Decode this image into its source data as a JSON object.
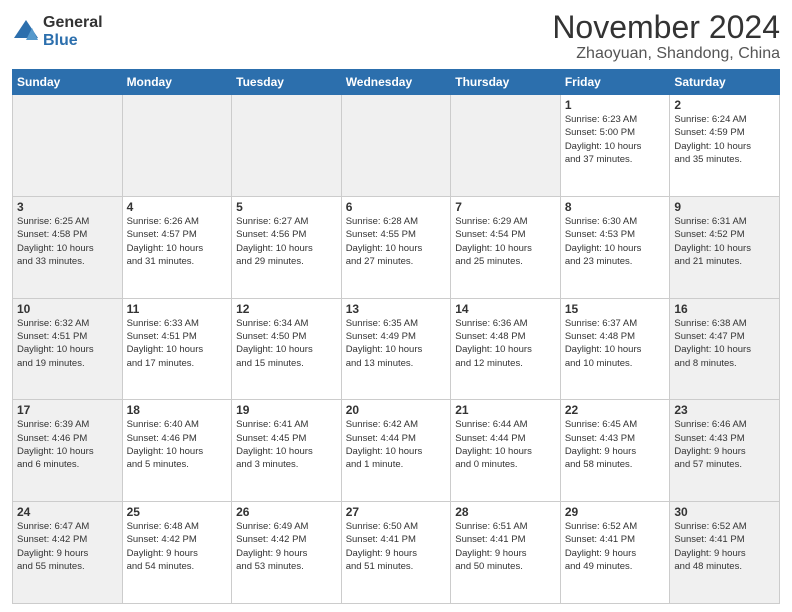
{
  "logo": {
    "general": "General",
    "blue": "Blue"
  },
  "header": {
    "month": "November 2024",
    "location": "Zhaoyuan, Shandong, China"
  },
  "weekdays": [
    "Sunday",
    "Monday",
    "Tuesday",
    "Wednesday",
    "Thursday",
    "Friday",
    "Saturday"
  ],
  "weeks": [
    [
      {
        "day": "",
        "info": "",
        "shaded": true
      },
      {
        "day": "",
        "info": "",
        "shaded": true
      },
      {
        "day": "",
        "info": "",
        "shaded": true
      },
      {
        "day": "",
        "info": "",
        "shaded": true
      },
      {
        "day": "",
        "info": "",
        "shaded": true
      },
      {
        "day": "1",
        "info": "Sunrise: 6:23 AM\nSunset: 5:00 PM\nDaylight: 10 hours\nand 37 minutes.",
        "shaded": false
      },
      {
        "day": "2",
        "info": "Sunrise: 6:24 AM\nSunset: 4:59 PM\nDaylight: 10 hours\nand 35 minutes.",
        "shaded": false
      }
    ],
    [
      {
        "day": "3",
        "info": "Sunrise: 6:25 AM\nSunset: 4:58 PM\nDaylight: 10 hours\nand 33 minutes.",
        "shaded": true
      },
      {
        "day": "4",
        "info": "Sunrise: 6:26 AM\nSunset: 4:57 PM\nDaylight: 10 hours\nand 31 minutes.",
        "shaded": false
      },
      {
        "day": "5",
        "info": "Sunrise: 6:27 AM\nSunset: 4:56 PM\nDaylight: 10 hours\nand 29 minutes.",
        "shaded": false
      },
      {
        "day": "6",
        "info": "Sunrise: 6:28 AM\nSunset: 4:55 PM\nDaylight: 10 hours\nand 27 minutes.",
        "shaded": false
      },
      {
        "day": "7",
        "info": "Sunrise: 6:29 AM\nSunset: 4:54 PM\nDaylight: 10 hours\nand 25 minutes.",
        "shaded": false
      },
      {
        "day": "8",
        "info": "Sunrise: 6:30 AM\nSunset: 4:53 PM\nDaylight: 10 hours\nand 23 minutes.",
        "shaded": false
      },
      {
        "day": "9",
        "info": "Sunrise: 6:31 AM\nSunset: 4:52 PM\nDaylight: 10 hours\nand 21 minutes.",
        "shaded": true
      }
    ],
    [
      {
        "day": "10",
        "info": "Sunrise: 6:32 AM\nSunset: 4:51 PM\nDaylight: 10 hours\nand 19 minutes.",
        "shaded": true
      },
      {
        "day": "11",
        "info": "Sunrise: 6:33 AM\nSunset: 4:51 PM\nDaylight: 10 hours\nand 17 minutes.",
        "shaded": false
      },
      {
        "day": "12",
        "info": "Sunrise: 6:34 AM\nSunset: 4:50 PM\nDaylight: 10 hours\nand 15 minutes.",
        "shaded": false
      },
      {
        "day": "13",
        "info": "Sunrise: 6:35 AM\nSunset: 4:49 PM\nDaylight: 10 hours\nand 13 minutes.",
        "shaded": false
      },
      {
        "day": "14",
        "info": "Sunrise: 6:36 AM\nSunset: 4:48 PM\nDaylight: 10 hours\nand 12 minutes.",
        "shaded": false
      },
      {
        "day": "15",
        "info": "Sunrise: 6:37 AM\nSunset: 4:48 PM\nDaylight: 10 hours\nand 10 minutes.",
        "shaded": false
      },
      {
        "day": "16",
        "info": "Sunrise: 6:38 AM\nSunset: 4:47 PM\nDaylight: 10 hours\nand 8 minutes.",
        "shaded": true
      }
    ],
    [
      {
        "day": "17",
        "info": "Sunrise: 6:39 AM\nSunset: 4:46 PM\nDaylight: 10 hours\nand 6 minutes.",
        "shaded": true
      },
      {
        "day": "18",
        "info": "Sunrise: 6:40 AM\nSunset: 4:46 PM\nDaylight: 10 hours\nand 5 minutes.",
        "shaded": false
      },
      {
        "day": "19",
        "info": "Sunrise: 6:41 AM\nSunset: 4:45 PM\nDaylight: 10 hours\nand 3 minutes.",
        "shaded": false
      },
      {
        "day": "20",
        "info": "Sunrise: 6:42 AM\nSunset: 4:44 PM\nDaylight: 10 hours\nand 1 minute.",
        "shaded": false
      },
      {
        "day": "21",
        "info": "Sunrise: 6:44 AM\nSunset: 4:44 PM\nDaylight: 10 hours\nand 0 minutes.",
        "shaded": false
      },
      {
        "day": "22",
        "info": "Sunrise: 6:45 AM\nSunset: 4:43 PM\nDaylight: 9 hours\nand 58 minutes.",
        "shaded": false
      },
      {
        "day": "23",
        "info": "Sunrise: 6:46 AM\nSunset: 4:43 PM\nDaylight: 9 hours\nand 57 minutes.",
        "shaded": true
      }
    ],
    [
      {
        "day": "24",
        "info": "Sunrise: 6:47 AM\nSunset: 4:42 PM\nDaylight: 9 hours\nand 55 minutes.",
        "shaded": true
      },
      {
        "day": "25",
        "info": "Sunrise: 6:48 AM\nSunset: 4:42 PM\nDaylight: 9 hours\nand 54 minutes.",
        "shaded": false
      },
      {
        "day": "26",
        "info": "Sunrise: 6:49 AM\nSunset: 4:42 PM\nDaylight: 9 hours\nand 53 minutes.",
        "shaded": false
      },
      {
        "day": "27",
        "info": "Sunrise: 6:50 AM\nSunset: 4:41 PM\nDaylight: 9 hours\nand 51 minutes.",
        "shaded": false
      },
      {
        "day": "28",
        "info": "Sunrise: 6:51 AM\nSunset: 4:41 PM\nDaylight: 9 hours\nand 50 minutes.",
        "shaded": false
      },
      {
        "day": "29",
        "info": "Sunrise: 6:52 AM\nSunset: 4:41 PM\nDaylight: 9 hours\nand 49 minutes.",
        "shaded": false
      },
      {
        "day": "30",
        "info": "Sunrise: 6:52 AM\nSunset: 4:41 PM\nDaylight: 9 hours\nand 48 minutes.",
        "shaded": true
      }
    ]
  ]
}
